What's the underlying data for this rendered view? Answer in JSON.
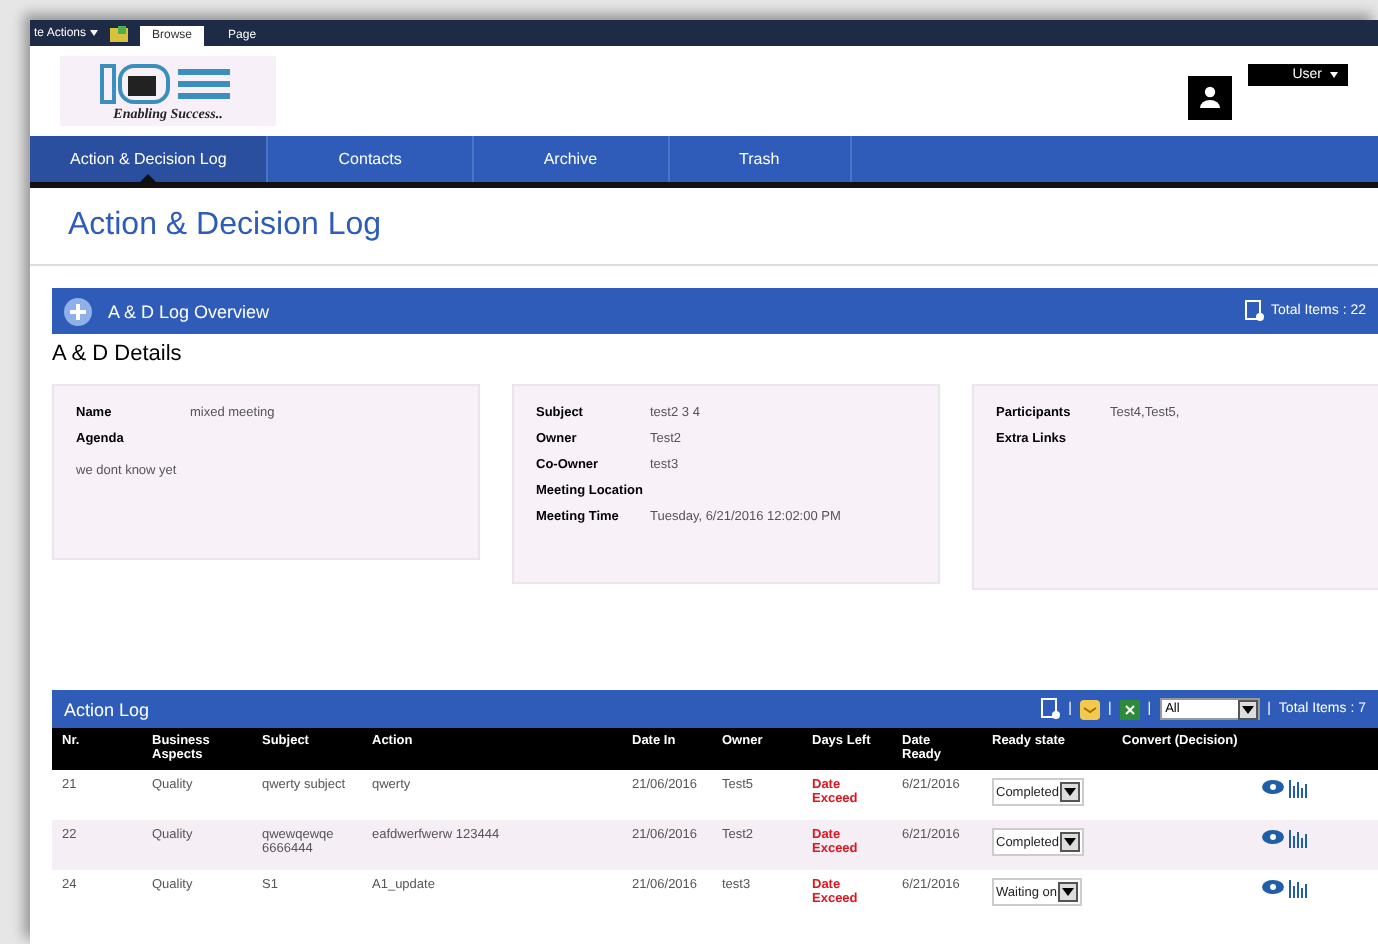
{
  "ribbon": {
    "menu": "te Actions",
    "tabs": [
      {
        "label": "Browse",
        "selected": true
      },
      {
        "label": "Page",
        "selected": false
      }
    ]
  },
  "header": {
    "logo_tagline": "Enabling Success..",
    "user": "User"
  },
  "nav": [
    {
      "label": "Action & Decision Log",
      "selected": true
    },
    {
      "label": "Contacts",
      "selected": false
    },
    {
      "label": "Archive",
      "selected": false
    },
    {
      "label": "Trash",
      "selected": false
    }
  ],
  "page_title": "Action & Decision Log",
  "overview": {
    "title": "A & D Log Overview",
    "total": "Total Items : 22"
  },
  "details": {
    "title": "A & D Details",
    "cards": [
      {
        "fields": [
          {
            "label": "Name",
            "value": "mixed meeting"
          },
          {
            "label": "Agenda"
          }
        ],
        "note": "we dont know yet"
      },
      {
        "fields": [
          {
            "label": "Subject",
            "value": "test2 3 4"
          },
          {
            "label": "Owner",
            "value": "Test2"
          },
          {
            "label": "Co-Owner",
            "value": "test3"
          },
          {
            "label": "Meeting Location"
          },
          {
            "label": "Meeting Time",
            "value": "Tuesday, 6/21/2016 12:02:00 PM"
          }
        ]
      },
      {
        "fields": [
          {
            "label": "Participants",
            "value": "Test4,Test5,"
          },
          {
            "label": "Extra Links"
          }
        ]
      }
    ]
  },
  "action_log": {
    "title": "Action Log",
    "filter": "All",
    "separators": [
      "|",
      "|",
      "|",
      "|"
    ],
    "total": "Total Items : 7",
    "columns": [
      "Nr.",
      "Business Aspects",
      "Subject",
      "Action",
      "Date In",
      "Owner",
      "Days Left",
      "Date Ready",
      "Ready state",
      "Convert (Decision)"
    ],
    "rows": [
      {
        "nr": "21",
        "aspect": "Quality",
        "subject": "qwerty subject",
        "action": "qwerty",
        "date_in": "21/06/2016",
        "owner": "Test5",
        "days_left": "Date Exceed",
        "date_ready": "6/21/2016",
        "state": "Completed"
      },
      {
        "nr": "22",
        "aspect": "Quality",
        "subject": "qwewqewqe 6666444",
        "action": "eafdwerfwerw 123444",
        "date_in": "21/06/2016",
        "owner": "Test2",
        "days_left": "Date Exceed",
        "date_ready": "6/21/2016",
        "state": "Completed"
      },
      {
        "nr": "24",
        "aspect": "Quality",
        "subject": "S1",
        "action": "A1_update",
        "date_in": "21/06/2016",
        "owner": "test3",
        "days_left": "Date Exceed",
        "date_ready": "6/21/2016",
        "state": "Waiting on"
      }
    ]
  }
}
